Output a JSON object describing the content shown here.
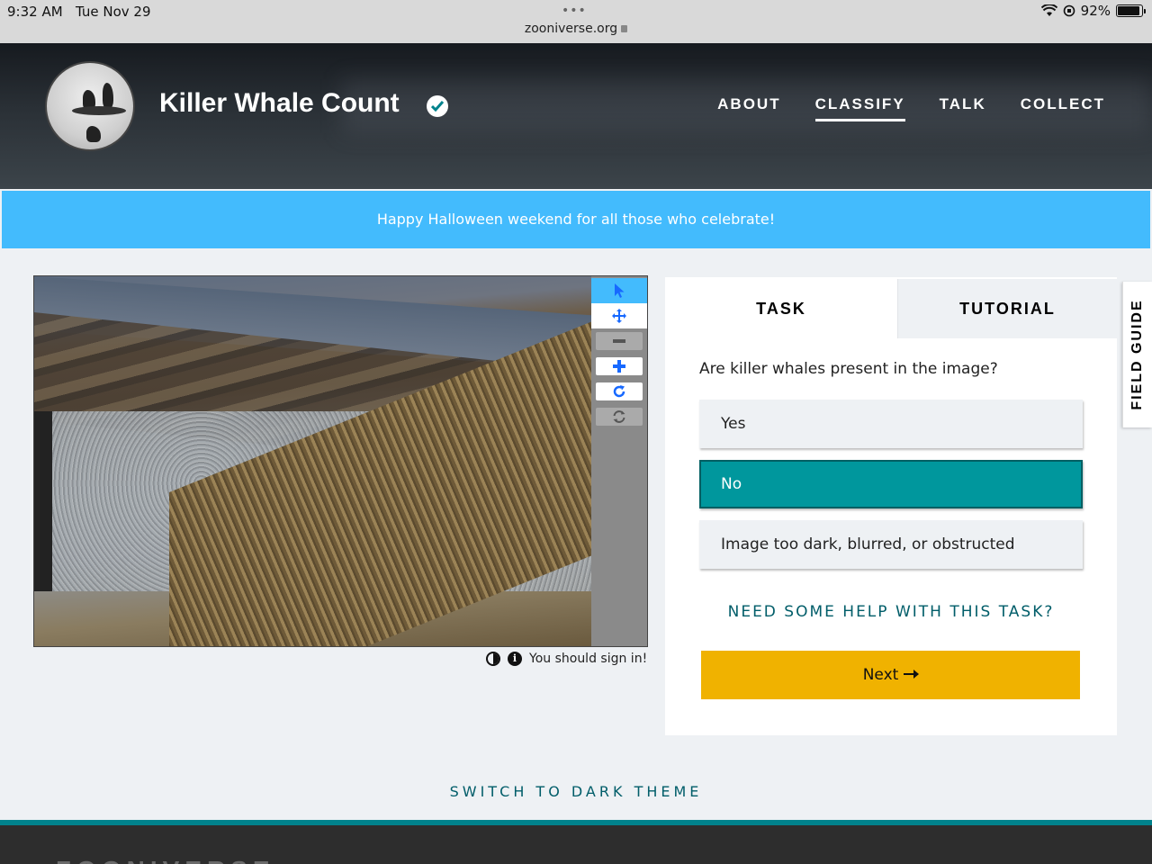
{
  "status_bar": {
    "time": "9:32 AM",
    "date": "Tue Nov 29",
    "url": "zooniverse.org",
    "battery": "92%",
    "battery_level": 0.92
  },
  "project": {
    "title": "Killer Whale Count",
    "nav": [
      "ABOUT",
      "CLASSIFY",
      "TALK",
      "COLLECT"
    ],
    "active_nav": "CLASSIFY"
  },
  "announcement": "Happy Halloween weekend for all those who celebrate!",
  "viewer": {
    "footer_text": "You should sign in!"
  },
  "task_panel": {
    "tabs": [
      "TASK",
      "TUTORIAL"
    ],
    "question": "Are killer whales present in the image?",
    "answers": [
      "Yes",
      "No",
      "Image too dark, blurred, or obstructed"
    ],
    "selected_answer": "No",
    "help_link": "NEED SOME HELP WITH THIS TASK?",
    "next_label": "Next"
  },
  "field_guide": "FIELD GUIDE",
  "theme_toggle": "SWITCH TO DARK THEME",
  "footer": {
    "logo": "ZOONIVERSE"
  },
  "colors": {
    "announcement": "#43bbfd",
    "selected_answer": "#00979d",
    "next_button": "#f0b200",
    "link": "#005d69"
  }
}
